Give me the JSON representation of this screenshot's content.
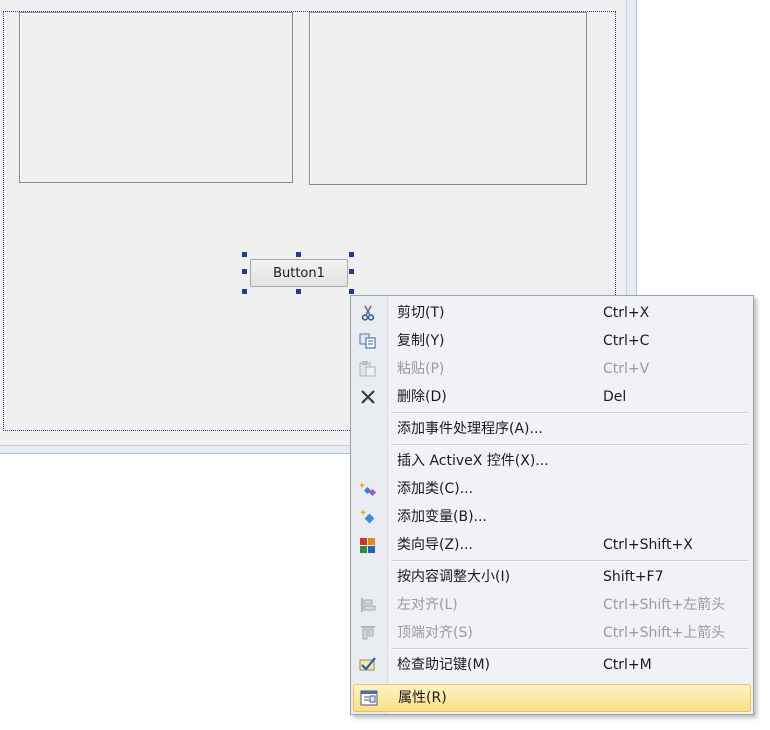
{
  "designer": {
    "button_control_label": "Button1"
  },
  "context_menu": {
    "items": [
      {
        "label": "剪切(T)",
        "shortcut": "Ctrl+X",
        "icon": "scissors-icon",
        "enabled": true
      },
      {
        "label": "复制(Y)",
        "shortcut": "Ctrl+C",
        "icon": "copy-icon",
        "enabled": true
      },
      {
        "label": "粘贴(P)",
        "shortcut": "Ctrl+V",
        "icon": "paste-icon",
        "enabled": false
      },
      {
        "label": "删除(D)",
        "shortcut": "Del",
        "icon": "delete-x-icon",
        "enabled": true
      },
      {
        "label": "添加事件处理程序(A)...",
        "shortcut": "",
        "icon": "",
        "enabled": true
      },
      {
        "label": "插入 ActiveX 控件(X)...",
        "shortcut": "",
        "icon": "",
        "enabled": true
      },
      {
        "label": "添加类(C)...",
        "shortcut": "",
        "icon": "add-class-icon",
        "enabled": true
      },
      {
        "label": "添加变量(B)...",
        "shortcut": "",
        "icon": "add-variable-icon",
        "enabled": true
      },
      {
        "label": "类向导(Z)...",
        "shortcut": "Ctrl+Shift+X",
        "icon": "class-wizard-icon",
        "enabled": true
      },
      {
        "label": "按内容调整大小(I)",
        "shortcut": "Shift+F7",
        "icon": "",
        "enabled": true
      },
      {
        "label": "左对齐(L)",
        "shortcut": "Ctrl+Shift+左箭头",
        "icon": "align-left-icon",
        "enabled": false
      },
      {
        "label": "顶端对齐(S)",
        "shortcut": "Ctrl+Shift+上箭头",
        "icon": "align-top-icon",
        "enabled": false
      },
      {
        "label": "检查助记键(M)",
        "shortcut": "Ctrl+M",
        "icon": "check-mnemonics-icon",
        "enabled": true
      },
      {
        "label": "属性(R)",
        "shortcut": "",
        "icon": "properties-icon",
        "enabled": true,
        "highlighted": true
      }
    ]
  },
  "colors": {
    "highlight": "#fbdf86",
    "selection_handle": "#1f3d8a",
    "disabled_text": "#9a9a9a"
  }
}
